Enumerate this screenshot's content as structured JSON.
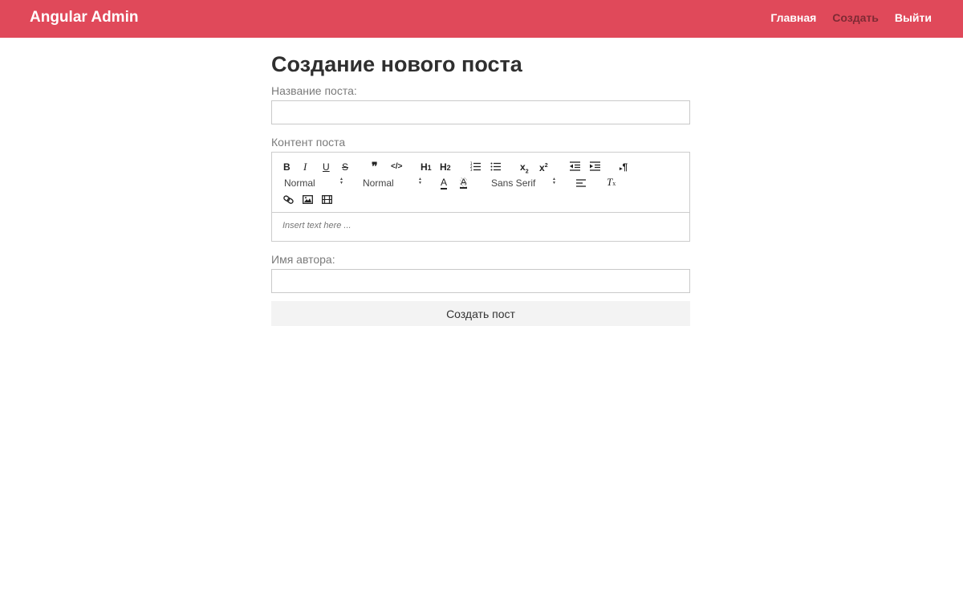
{
  "navbar": {
    "brand": "Angular Admin",
    "links": [
      {
        "label": "Главная",
        "active": false
      },
      {
        "label": "Создать",
        "active": true
      },
      {
        "label": "Выйти",
        "active": false
      }
    ],
    "color": "#e0495a"
  },
  "form": {
    "title": "Создание нового поста",
    "title_label": "Название поста:",
    "title_value": "",
    "content_label": "Контент поста",
    "author_label": "Имя автора:",
    "author_value": "",
    "submit_label": "Создать пост"
  },
  "editor": {
    "header_picker": "Normal",
    "size_picker": "Normal",
    "font_picker": "Sans Serif",
    "placeholder": "Insert text here ..."
  }
}
